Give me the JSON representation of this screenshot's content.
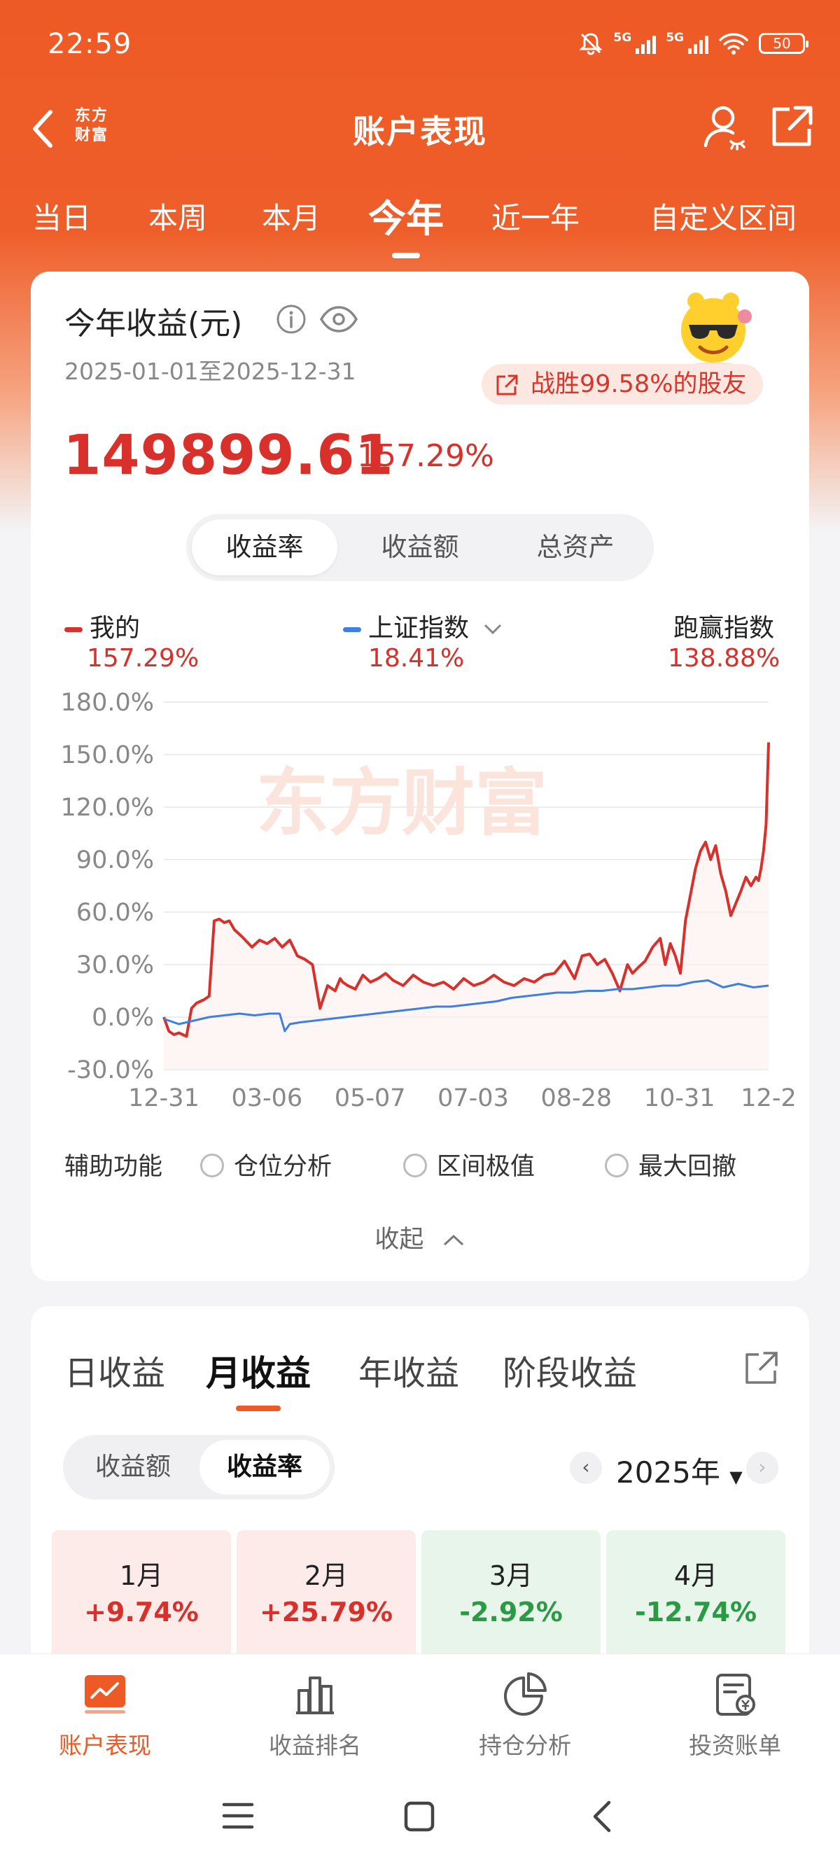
{
  "status": {
    "time": "22:59",
    "net1": "5G",
    "net2": "5G",
    "battery": "50"
  },
  "header": {
    "title": "账户表现",
    "logo_line1": "东方",
    "logo_line2": "财富"
  },
  "period_tabs": [
    "当日",
    "本周",
    "本月",
    "今年",
    "近一年",
    "自定义区间"
  ],
  "active_period": "今年",
  "summary": {
    "title": "今年收益(元)",
    "date_range": "2025-01-01至2025-12-31",
    "badge": "战胜99.58%的股友",
    "amount": "149899.61",
    "return_pct": "157.29%"
  },
  "chart_tabs": [
    "收益率",
    "收益额",
    "总资产"
  ],
  "legend": {
    "mine_label": "我的",
    "mine_value": "157.29%",
    "index_label": "上证指数",
    "index_value": "18.41%",
    "beat_label": "跑赢指数",
    "beat_value": "138.88%"
  },
  "watermark": "东方财富",
  "colors": {
    "brand": "#ee5a26",
    "mine": "#d8302a",
    "index": "#3f7fe0",
    "positive": "#d8302a",
    "negative": "#2a9a44"
  },
  "chart_data": {
    "type": "line",
    "x_tick_labels": [
      "12-31",
      "03-06",
      "05-07",
      "07-03",
      "08-28",
      "10-31",
      "12-2"
    ],
    "y_tick_labels": [
      "180.0%",
      "150.0%",
      "120.0%",
      "90.0%",
      "60.0%",
      "30.0%",
      "0.0%",
      "-30.0%"
    ],
    "ylim": [
      -30,
      180
    ],
    "grid": true,
    "x_index_range": [
      0,
      240
    ],
    "series": [
      {
        "name": "我的",
        "color": "#d8302a",
        "x": [
          0,
          2,
          4,
          6,
          9,
          11,
          13,
          16,
          18,
          20,
          22,
          24,
          26,
          28,
          31,
          35,
          38,
          41,
          44,
          47,
          50,
          53,
          56,
          59,
          62,
          65,
          68,
          70,
          71,
          73,
          76,
          79,
          82,
          85,
          88,
          91,
          95,
          99,
          103,
          107,
          111,
          115,
          119,
          123,
          127,
          131,
          135,
          139,
          143,
          147,
          151,
          155,
          159,
          163,
          166,
          169,
          172,
          175,
          178,
          181,
          184,
          186,
          188,
          191,
          194,
          197,
          199,
          201,
          203,
          205,
          207,
          209,
          211,
          213,
          215,
          217,
          219,
          221,
          223,
          225,
          227,
          229,
          231,
          233,
          235,
          236,
          237,
          238,
          239,
          240
        ],
        "y": [
          0,
          -8,
          -10,
          -9,
          -11,
          5,
          8,
          10,
          12,
          55,
          56,
          54,
          55,
          50,
          46,
          40,
          44,
          42,
          45,
          40,
          44,
          35,
          33,
          30,
          5,
          18,
          15,
          22,
          20,
          18,
          16,
          24,
          20,
          22,
          25,
          21,
          18,
          24,
          20,
          18,
          20,
          16,
          22,
          18,
          20,
          24,
          20,
          18,
          22,
          20,
          24,
          25,
          32,
          22,
          35,
          36,
          30,
          33,
          25,
          15,
          30,
          25,
          28,
          32,
          40,
          45,
          30,
          42,
          35,
          25,
          55,
          70,
          85,
          95,
          100,
          90,
          98,
          82,
          72,
          58,
          65,
          72,
          80,
          75,
          80,
          78,
          85,
          95,
          110,
          157
        ]
      },
      {
        "name": "上证指数",
        "color": "#3f7fe0",
        "x": [
          0,
          6,
          12,
          18,
          24,
          30,
          36,
          42,
          46,
          48,
          50,
          54,
          60,
          66,
          72,
          78,
          84,
          90,
          96,
          102,
          108,
          114,
          120,
          126,
          132,
          138,
          144,
          150,
          156,
          162,
          168,
          174,
          180,
          186,
          192,
          198,
          204,
          210,
          216,
          222,
          228,
          234,
          240
        ],
        "y": [
          -1,
          -4,
          -2,
          0,
          1,
          2,
          1,
          2,
          2,
          -8,
          -4,
          -3,
          -2,
          -1,
          0,
          1,
          2,
          3,
          4,
          5,
          6,
          6,
          7,
          8,
          9,
          11,
          12,
          13,
          14,
          14,
          15,
          15,
          16,
          16,
          17,
          18,
          18,
          20,
          21,
          17,
          19,
          17,
          18
        ]
      }
    ]
  },
  "aux": {
    "label": "辅助功能",
    "options": [
      "仓位分析",
      "区间极值",
      "最大回撤"
    ]
  },
  "collapse_label": "收起",
  "monthly": {
    "tabs": [
      "日收益",
      "月收益",
      "年收益",
      "阶段收益"
    ],
    "active_tab": "月收益",
    "toggle": [
      "收益额",
      "收益率"
    ],
    "year": "2025年",
    "cells": [
      {
        "month": "1月",
        "value": "+9.74%",
        "sign": "pos"
      },
      {
        "month": "2月",
        "value": "+25.79%",
        "sign": "pos"
      },
      {
        "month": "3月",
        "value": "-2.92%",
        "sign": "neg"
      },
      {
        "month": "4月",
        "value": "-12.74%",
        "sign": "neg"
      }
    ]
  },
  "bottom_nav": [
    "账户表现",
    "收益排名",
    "持仓分析",
    "投资账单"
  ],
  "icons": [
    "back-arrow-icon",
    "user-icon",
    "share-icon",
    "info-icon",
    "eye-icon",
    "chevron-down-icon",
    "chevron-up-icon",
    "export-icon",
    "chart-icon",
    "bar-chart-icon",
    "pie-chart-icon",
    "bill-icon",
    "menu-icon",
    "home-icon",
    "back-icon"
  ]
}
